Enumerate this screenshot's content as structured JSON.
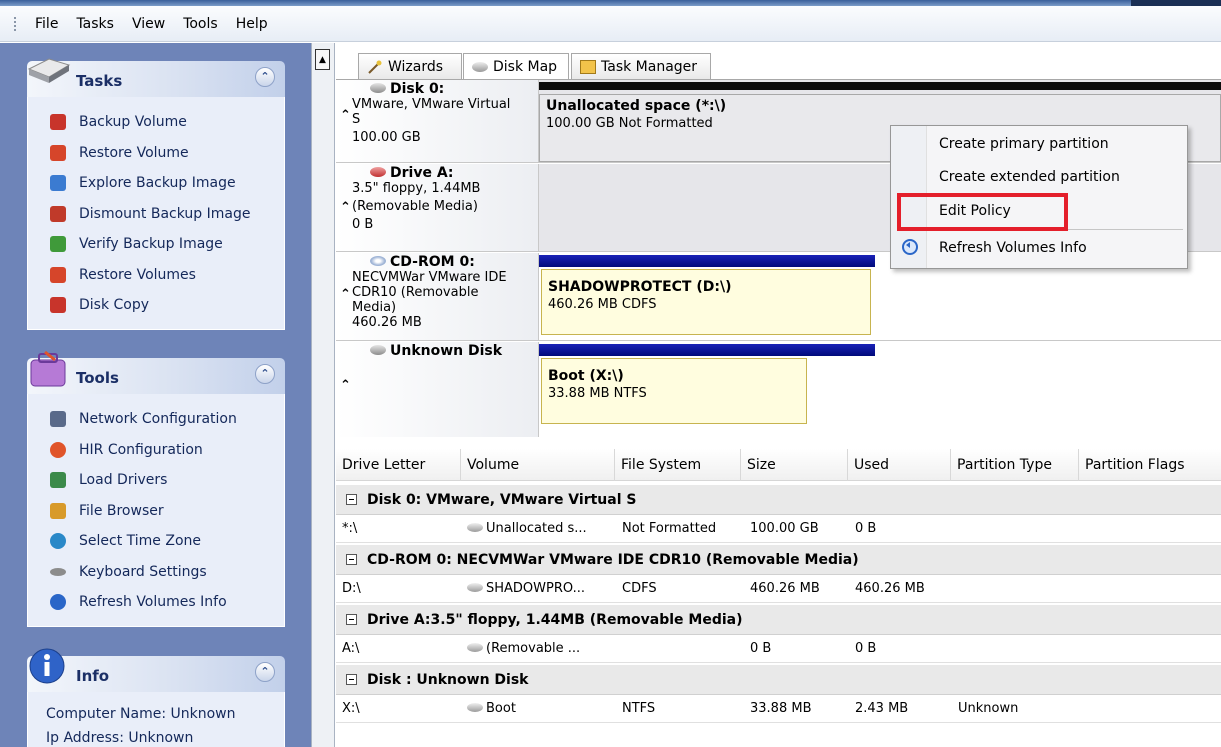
{
  "menu": [
    "File",
    "Tasks",
    "View",
    "Tools",
    "Help"
  ],
  "tasks_panel": {
    "title": "Tasks",
    "items": [
      {
        "label": "Backup Volume",
        "icon": "backup-icon",
        "color": "#c8342b"
      },
      {
        "label": "Restore Volume",
        "icon": "restore-icon",
        "color": "#d6452a"
      },
      {
        "label": "Explore Backup Image",
        "icon": "explore-icon",
        "color": "#3b7bd1"
      },
      {
        "label": "Dismount Backup Image",
        "icon": "dismount-icon",
        "color": "#c03a2a"
      },
      {
        "label": "Verify Backup Image",
        "icon": "verify-icon",
        "color": "#3f9a3a"
      },
      {
        "label": "Restore Volumes",
        "icon": "restore-volumes-icon",
        "color": "#d6452a"
      },
      {
        "label": "Disk Copy",
        "icon": "disk-copy-icon",
        "color": "#c8342b"
      }
    ]
  },
  "tools_panel": {
    "title": "Tools",
    "items": [
      {
        "label": "Network Configuration",
        "icon": "network-icon",
        "color": "#5a6a8a"
      },
      {
        "label": "HIR Configuration",
        "icon": "hir-icon",
        "color": "#e0542a"
      },
      {
        "label": "Load Drivers",
        "icon": "drivers-icon",
        "color": "#3b8a4a"
      },
      {
        "label": "File Browser",
        "icon": "file-browser-icon",
        "color": "#d89a2a"
      },
      {
        "label": "Select Time Zone",
        "icon": "time-zone-icon",
        "color": "#2a88c8"
      },
      {
        "label": "Keyboard Settings",
        "icon": "keyboard-icon",
        "color": "#8c8c8c"
      },
      {
        "label": "Refresh Volumes Info",
        "icon": "refresh-icon",
        "color": "#2a66c8"
      }
    ]
  },
  "info_panel": {
    "title": "Info",
    "lines": [
      "Computer Name: Unknown",
      "Ip Address: Unknown"
    ]
  },
  "tabs": [
    "Wizards",
    "Disk Map",
    "Task Manager"
  ],
  "disk_map": [
    {
      "header": "Disk 0:",
      "lines": [
        "VMware, VMware Virtual",
        "S",
        "100.00 GB"
      ],
      "volumes": [
        {
          "title": "Unallocated space (*:\\)",
          "detail": "100.00 GB Not Formatted"
        }
      ]
    },
    {
      "header": "Drive A:",
      "lines": [
        "3.5\" floppy, 1.44MB",
        "(Removable Media)",
        "0 B"
      ],
      "volumes": []
    },
    {
      "header": "CD-ROM 0:",
      "lines": [
        "NECVMWar VMware IDE",
        "CDR10 (Removable",
        "Media)",
        "460.26 MB"
      ],
      "volumes": [
        {
          "title": "SHADOWPROTECT (D:\\)",
          "detail": "460.26 MB CDFS"
        }
      ]
    },
    {
      "header": "Unknown Disk",
      "lines": [],
      "volumes": [
        {
          "title": "Boot (X:\\)",
          "detail": "33.88 MB NTFS"
        }
      ]
    }
  ],
  "context_menu": [
    "Create primary partition",
    "Create extended partition",
    "Edit Policy",
    "Refresh Volumes Info"
  ],
  "grid": {
    "columns": [
      "Drive Letter",
      "Volume",
      "File System",
      "Size",
      "Used",
      "Partition Type",
      "Partition Flags"
    ],
    "groups": [
      {
        "title": "Disk 0: VMware, VMware Virtual S",
        "rows": [
          [
            "*:\\",
            "Unallocated s...",
            "Not Formatted",
            "100.00 GB",
            "0 B",
            "",
            ""
          ]
        ]
      },
      {
        "title": "CD-ROM 0: NECVMWar VMware IDE CDR10 (Removable Media)",
        "rows": [
          [
            "D:\\",
            "SHADOWPRO...",
            "CDFS",
            "460.26 MB",
            "460.26 MB",
            "",
            ""
          ]
        ]
      },
      {
        "title": "Drive A:3.5\" floppy, 1.44MB (Removable Media)",
        "rows": [
          [
            "A:\\",
            "(Removable ...",
            "",
            "0 B",
            "0 B",
            "",
            ""
          ]
        ]
      },
      {
        "title": "Disk : Unknown Disk",
        "rows": [
          [
            "X:\\",
            "Boot",
            "NTFS",
            "33.88 MB",
            "2.43 MB",
            "Unknown",
            ""
          ]
        ]
      }
    ]
  },
  "colors": {
    "pane_bg": "#6e84b8",
    "highlight_box": "#e41f2b",
    "volume_bar_blue": "#1a22b8"
  }
}
